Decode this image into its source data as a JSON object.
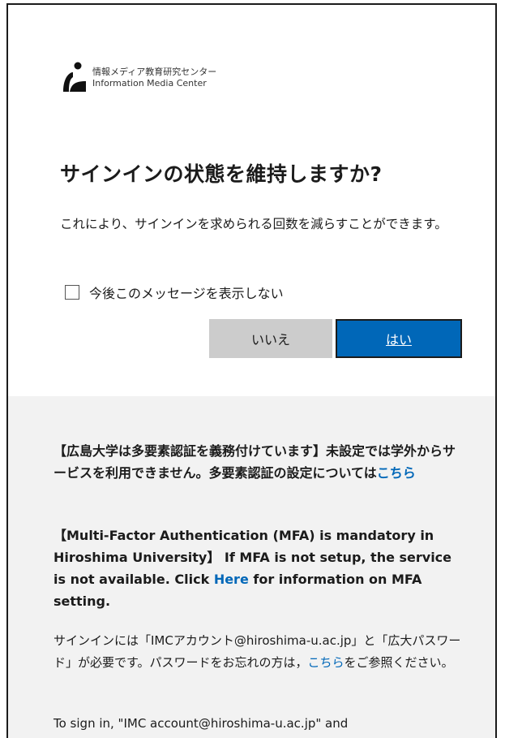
{
  "org": {
    "name_ja": "情報メディア教育研究センター",
    "name_en": "Information Media Center"
  },
  "dialog": {
    "title": "サインインの状態を維持しますか?",
    "description": "これにより、サインインを求められる回数を減らすことができます。",
    "checkbox_label": "今後このメッセージを表示しない",
    "checkbox_checked": false,
    "no_label": "いいえ",
    "yes_label": "はい"
  },
  "footer": {
    "notice_ja_text": "【広島大学は多要素認証を義務付けています】未設定では学外からサービスを利用できません。多要素認証の設定については",
    "notice_ja_link": "こちら",
    "notice_en_pre": "【Multi-Factor Authentication (MFA) is mandatory in Hiroshima University】 If MFA is not setup, the service is not available. Click ",
    "notice_en_link": "Here",
    "notice_en_post": " for information on MFA setting.",
    "info_ja_pre": "サインインには「IMCアカウント@hiroshima-u.ac.jp」と「広大パスワード」が必要です。パスワードをお忘れの方は，",
    "info_ja_link": "こちら",
    "info_ja_post": "をご参照ください。",
    "info_en_partial": "To sign in, \"IMC account@hiroshima-u.ac.jp\" and"
  },
  "colors": {
    "accent": "#0067b8",
    "secondary_button": "#cccccc",
    "footer_bg": "#f2f2f2",
    "text": "#1b1b1b"
  }
}
